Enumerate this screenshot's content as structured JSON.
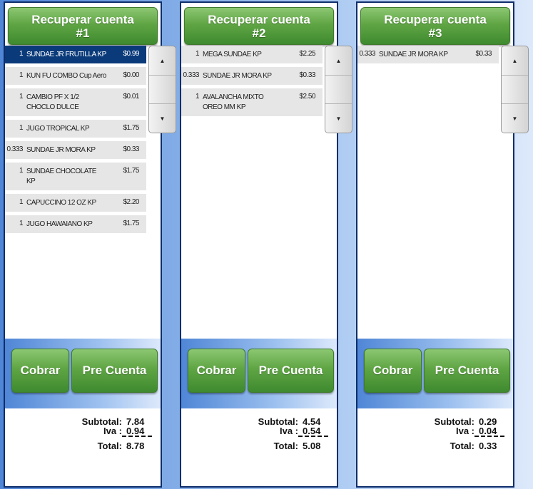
{
  "accounts": [
    {
      "title_line1": "Recuperar cuenta",
      "title_line2": "#1",
      "items": [
        {
          "qty": "1",
          "name": "SUNDAE JR FRUTILLA KP",
          "price": "$0.99",
          "selected": true
        },
        {
          "qty": "1",
          "name": "KUN FU COMBO Cup Aero",
          "price": "$0.00"
        },
        {
          "qty": "1",
          "name": "CAMBIO PF X 1/2 CHOCLO DULCE",
          "price": "$0.01"
        },
        {
          "qty": "1",
          "name": "JUGO TROPICAL KP",
          "price": "$1.75"
        },
        {
          "qty": "0.333",
          "name": "SUNDAE JR MORA KP",
          "price": "$0.33"
        },
        {
          "qty": "1",
          "name": "SUNDAE CHOCOLATE KP",
          "price": "$1.75"
        },
        {
          "qty": "1",
          "name": "CAPUCCINO 12 OZ KP",
          "price": "$2.20"
        },
        {
          "qty": "1",
          "name": "JUGO HAWAIANO KP",
          "price": "$1.75"
        }
      ],
      "cobrar_label": "Cobrar",
      "precuenta_label": "Pre Cuenta",
      "subtotal_label": "Subtotal:",
      "subtotal": "7.84",
      "iva_label": "Iva :",
      "iva": "0.94",
      "total_label": "Total:",
      "total": "8.78"
    },
    {
      "title_line1": "Recuperar cuenta",
      "title_line2": "#2",
      "items": [
        {
          "qty": "1",
          "name": "MEGA SUNDAE KP",
          "price": "$2.25"
        },
        {
          "qty": "0.333",
          "name": "SUNDAE JR MORA KP",
          "price": "$0.33"
        },
        {
          "qty": "1",
          "name": "AVALANCHA MIXTO OREO MM KP",
          "price": "$2.50"
        }
      ],
      "cobrar_label": "Cobrar",
      "precuenta_label": "Pre Cuenta",
      "subtotal_label": "Subtotal:",
      "subtotal": "4.54",
      "iva_label": "Iva :",
      "iva": "0.54",
      "total_label": "Total:",
      "total": "5.08"
    },
    {
      "title_line1": "Recuperar cuenta",
      "title_line2": "#3",
      "items": [
        {
          "qty": "0.333",
          "name": "SUNDAE JR MORA KP",
          "price": "$0.33"
        }
      ],
      "cobrar_label": "Cobrar",
      "precuenta_label": "Pre Cuenta",
      "subtotal_label": "Subtotal:",
      "subtotal": "0.29",
      "iva_label": "Iva :",
      "iva": "0.04",
      "total_label": "Total:",
      "total": "0.33"
    }
  ],
  "icons": {
    "scroll_up": "triangle-up-icon",
    "scroll_down": "triangle-down-icon"
  },
  "colors": {
    "button_green": "#5fa544",
    "panel_border": "#0e2d6b",
    "selected_row": "#0a3a7a",
    "row_bg": "#e6e6e6"
  }
}
